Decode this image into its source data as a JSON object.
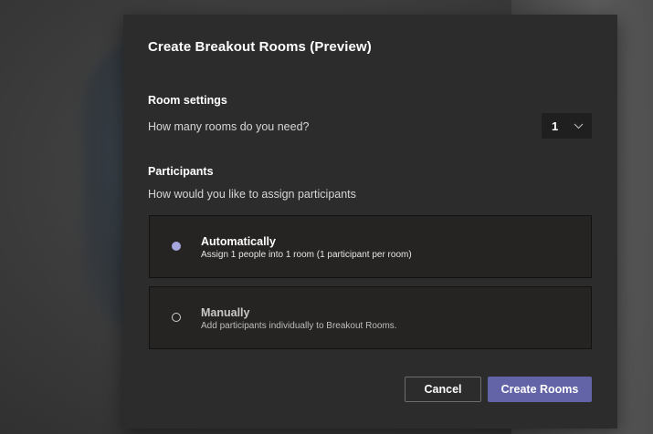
{
  "dialog": {
    "title": "Create Breakout Rooms (Preview)"
  },
  "room_settings": {
    "heading": "Room settings",
    "question": "How many rooms do you need?",
    "rooms_count": "1",
    "dropdown_icon": "chevron-down-icon"
  },
  "participants": {
    "heading": "Participants",
    "question": "How would you like to assign participants",
    "options": [
      {
        "title": "Automatically",
        "description": "Assign 1 people into 1 room (1 participant per room)",
        "selected": true
      },
      {
        "title": "Manually",
        "description": "Add participants individually to Breakout Rooms.",
        "selected": false
      }
    ]
  },
  "actions": {
    "cancel_label": "Cancel",
    "create_label": "Create Rooms"
  },
  "colors": {
    "accent": "#6264a7",
    "radio_selected": "#a6a7dc",
    "dialog_bg": "#2d2c2c",
    "card_bg": "#252423"
  }
}
